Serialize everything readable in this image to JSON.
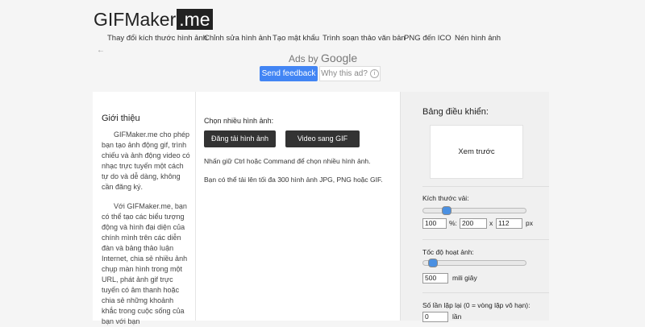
{
  "header": {
    "logo_text": "GIFMaker",
    "logo_suffix": ".me",
    "nav": [
      "Thay đổi kích thước hình ảnh",
      "Chỉnh sửa hình ảnh",
      "Tạo mật khẩu",
      "Trình soạn thảo văn bản",
      "PNG đến ICO",
      "Nén hình ảnh"
    ]
  },
  "ads": {
    "ads_by": "Ads by",
    "google": "Google",
    "send_feedback": "Send feedback",
    "why_this_ad": "Why this ad?"
  },
  "intro": {
    "title": "Giới thiệu",
    "para1": "GIFMaker.me cho phép bạn tạo ảnh động gif, trình chiếu và ảnh động video có nhạc trực tuyến một cách tự do và dễ dàng, không cần đăng ký.",
    "para2": "Với GIFMaker.me, bạn có thể tạo các biểu tượng động và hình đại diện của chính mình trên các diễn đàn và bảng thảo luận Internet, chia sẻ nhiều ảnh chụp màn hình trong một URL, phát ảnh gif trực tuyến có âm thanh hoặc chia sẻ những khoảnh khắc trong cuộc sống của bạn với bạn"
  },
  "upload": {
    "label": "Chọn nhiều hình ảnh:",
    "upload_button": "Đăng tải hình ảnh",
    "video_button": "Video sang GIF",
    "help1": "Nhấn giữ Ctrl hoặc Command để chọn nhiều hình ảnh.",
    "help2": "Bạn có thể tải lên tối đa 300 hình ảnh JPG, PNG hoặc GIF."
  },
  "panel": {
    "title": "Bảng điều khiển:",
    "preview": "Xem trước",
    "canvas_size_label": "Kích thước vải:",
    "canvas_percent": "100",
    "percent_sign": "%:",
    "width": "200",
    "times": "x",
    "height": "112",
    "px": "px",
    "canvas_slider_fraction": 0.2,
    "speed_label": "Tốc độ hoạt ảnh:",
    "speed_value": "500",
    "speed_unit": "mili giây",
    "speed_slider_fraction": 0.05,
    "repeat_label": "Số lần lặp lại (0 = vòng lặp vô hạn):",
    "repeat_value": "0",
    "repeat_unit": "lần"
  }
}
